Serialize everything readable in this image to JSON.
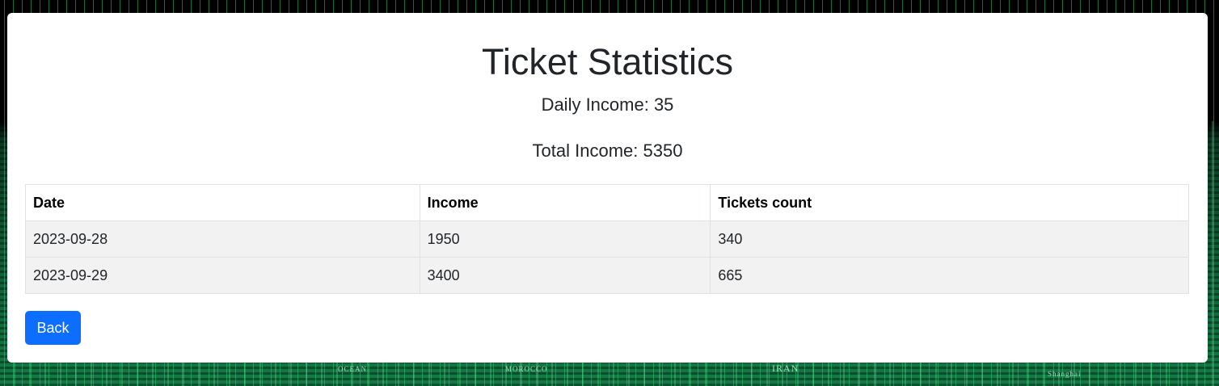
{
  "page": {
    "title": "Ticket Statistics",
    "daily_income_label": "Daily Income: 35",
    "total_income_label": "Total Income: 5350"
  },
  "table": {
    "headers": [
      "Date",
      "Income",
      "Tickets count"
    ],
    "rows": [
      [
        "2023-09-28",
        "1950",
        "340"
      ],
      [
        "2023-09-29",
        "3400",
        "665"
      ]
    ]
  },
  "actions": {
    "back_label": "Back"
  },
  "background": {
    "map_labels": [
      "OCEAN",
      "MOROCCO",
      "IRAN",
      "Shanghai"
    ]
  },
  "colors": {
    "primary": "#0d6efd",
    "card_background": "#ffffff",
    "row_background": "#f2f2f2",
    "border": "#dee2e6",
    "backdrop_green": "#127a45"
  }
}
